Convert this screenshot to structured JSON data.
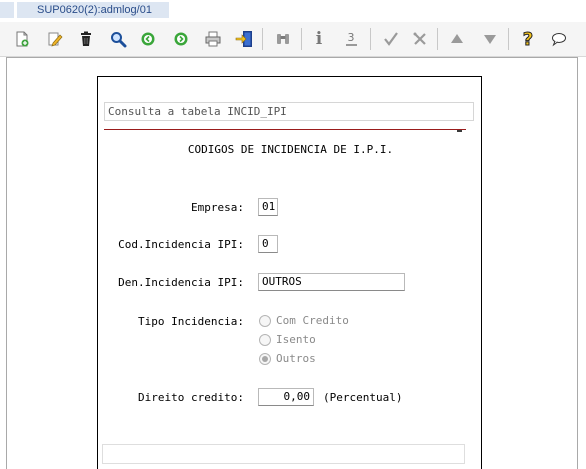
{
  "window": {
    "tab_title": "SUP0620(2):admlog/01"
  },
  "toolbar": {
    "buttons": [
      {
        "name": "new-icon"
      },
      {
        "name": "edit-icon"
      },
      {
        "name": "delete-icon"
      },
      {
        "name": "search-icon"
      },
      {
        "name": "previous-icon"
      },
      {
        "name": "next-icon"
      },
      {
        "name": "print-icon"
      },
      {
        "name": "exit-icon"
      },
      {
        "name": "binoculars-icon"
      },
      {
        "name": "info-icon"
      },
      {
        "name": "sequence-icon"
      },
      {
        "name": "confirm-icon"
      },
      {
        "name": "cancel-icon"
      },
      {
        "name": "up-icon"
      },
      {
        "name": "down-icon"
      },
      {
        "name": "help-icon"
      },
      {
        "name": "comment-icon"
      }
    ],
    "info_glyph": "i",
    "sequence_glyph": "3",
    "help_glyph": "?"
  },
  "form": {
    "title": "Consulta a tabela INCID_IPI",
    "heading": "CODIGOS DE INCIDENCIA DE I.P.I.",
    "empresa": {
      "label": "Empresa:",
      "value": "01"
    },
    "cod_incidencia": {
      "label": "Cod.Incidencia IPI:",
      "value": "0"
    },
    "den_incidencia": {
      "label": "Den.Incidencia IPI:",
      "value": "OUTROS"
    },
    "tipo_incidencia": {
      "label": "Tipo Incidencia:",
      "options": [
        "Com Credito",
        "Isento",
        "Outros"
      ],
      "selected": "Outros"
    },
    "direito_credito": {
      "label": "Direito credito:",
      "value": "0,00",
      "unit": "(Percentual)"
    }
  }
}
